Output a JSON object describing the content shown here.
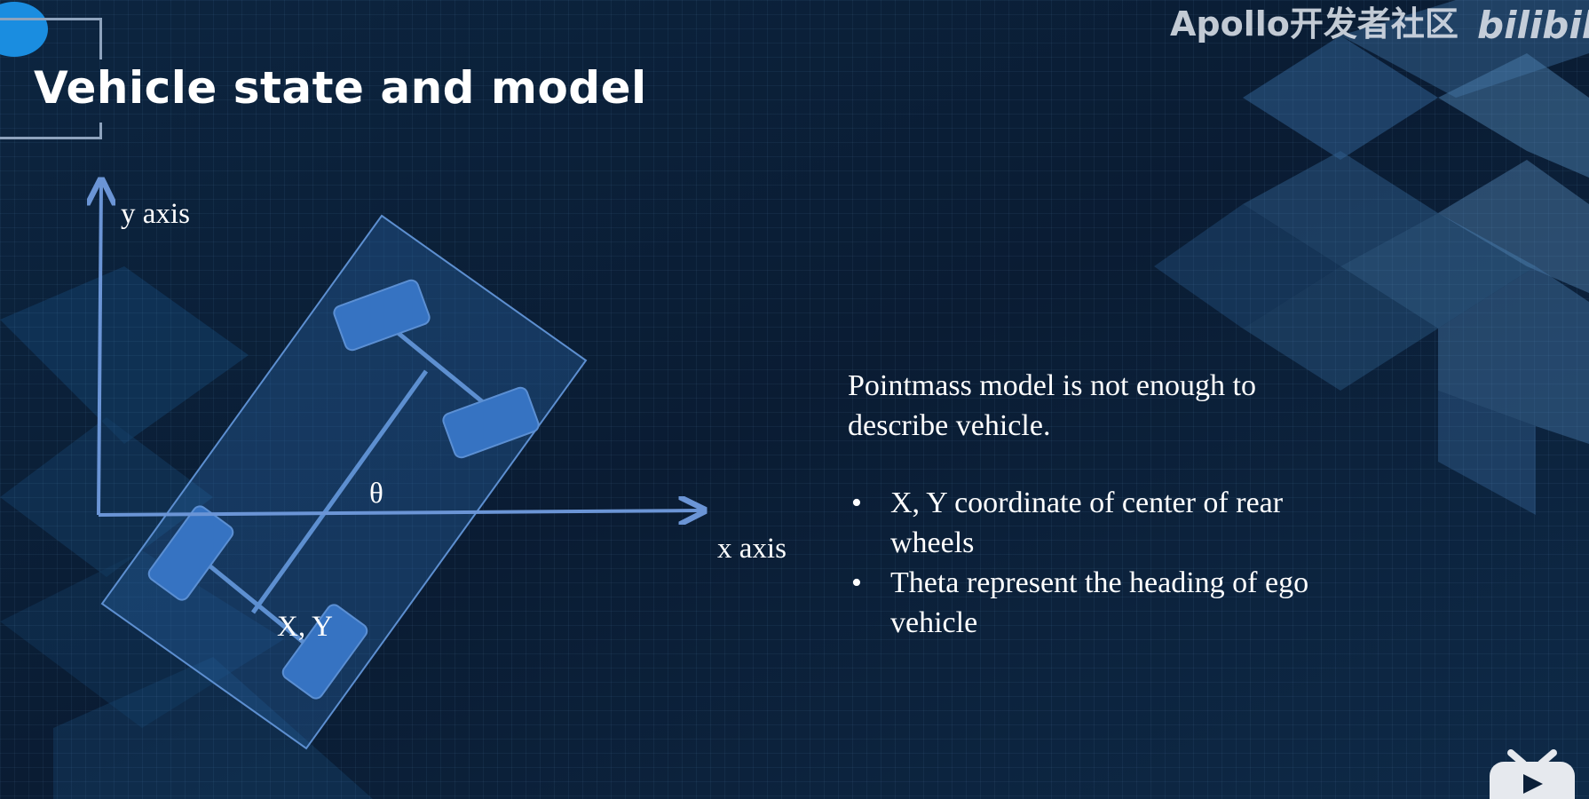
{
  "slide": {
    "title": "Vehicle state and model",
    "watermark": "Apollo开发者社区",
    "watermark_logo": "bilibili"
  },
  "diagram": {
    "y_axis_label": "y axis",
    "x_axis_label": "x axis",
    "angle_label": "θ",
    "point_label": "X, Y"
  },
  "description": {
    "intro": "Pointmass model is not enough to describe vehicle.",
    "bullets": [
      "X, Y coordinate of center of rear wheels",
      "Theta represent the heading of ego vehicle"
    ],
    "bullet_glyph": "•"
  },
  "colors": {
    "background": "#0b1f38",
    "accent": "#4a7fc9",
    "axis": "#6b95d6",
    "text": "#ffffff"
  },
  "icons": [
    "bilibili-tv-icon",
    "blue-dot-icon"
  ]
}
